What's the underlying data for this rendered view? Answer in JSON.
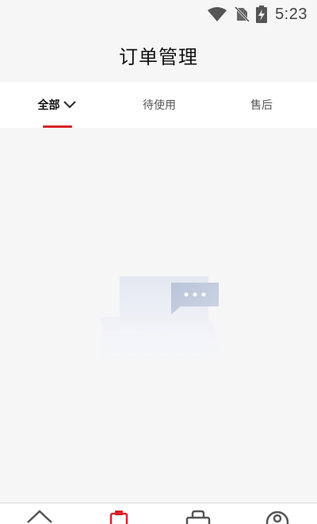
{
  "status_bar": {
    "time": "5:23",
    "icons": [
      "wifi-icon",
      "no-sim-icon",
      "battery-charging-icon"
    ]
  },
  "header": {
    "title": "订单管理"
  },
  "tabs": [
    {
      "label": "全部",
      "active": true,
      "has_dropdown": true
    },
    {
      "label": "待使用",
      "active": false
    },
    {
      "label": "售后",
      "active": false
    }
  ],
  "colors": {
    "accent": "#d8232a",
    "background": "#f6f6f6",
    "tab_bar": "#ffffff"
  },
  "empty_state": {
    "illustration": "empty-orders-illustration"
  },
  "bottom_nav": {
    "items": [
      {
        "icon": "home-icon",
        "active": false
      },
      {
        "icon": "orders-icon",
        "active": true
      },
      {
        "icon": "shopping-bag-icon",
        "active": false
      },
      {
        "icon": "profile-icon",
        "active": false
      }
    ]
  }
}
